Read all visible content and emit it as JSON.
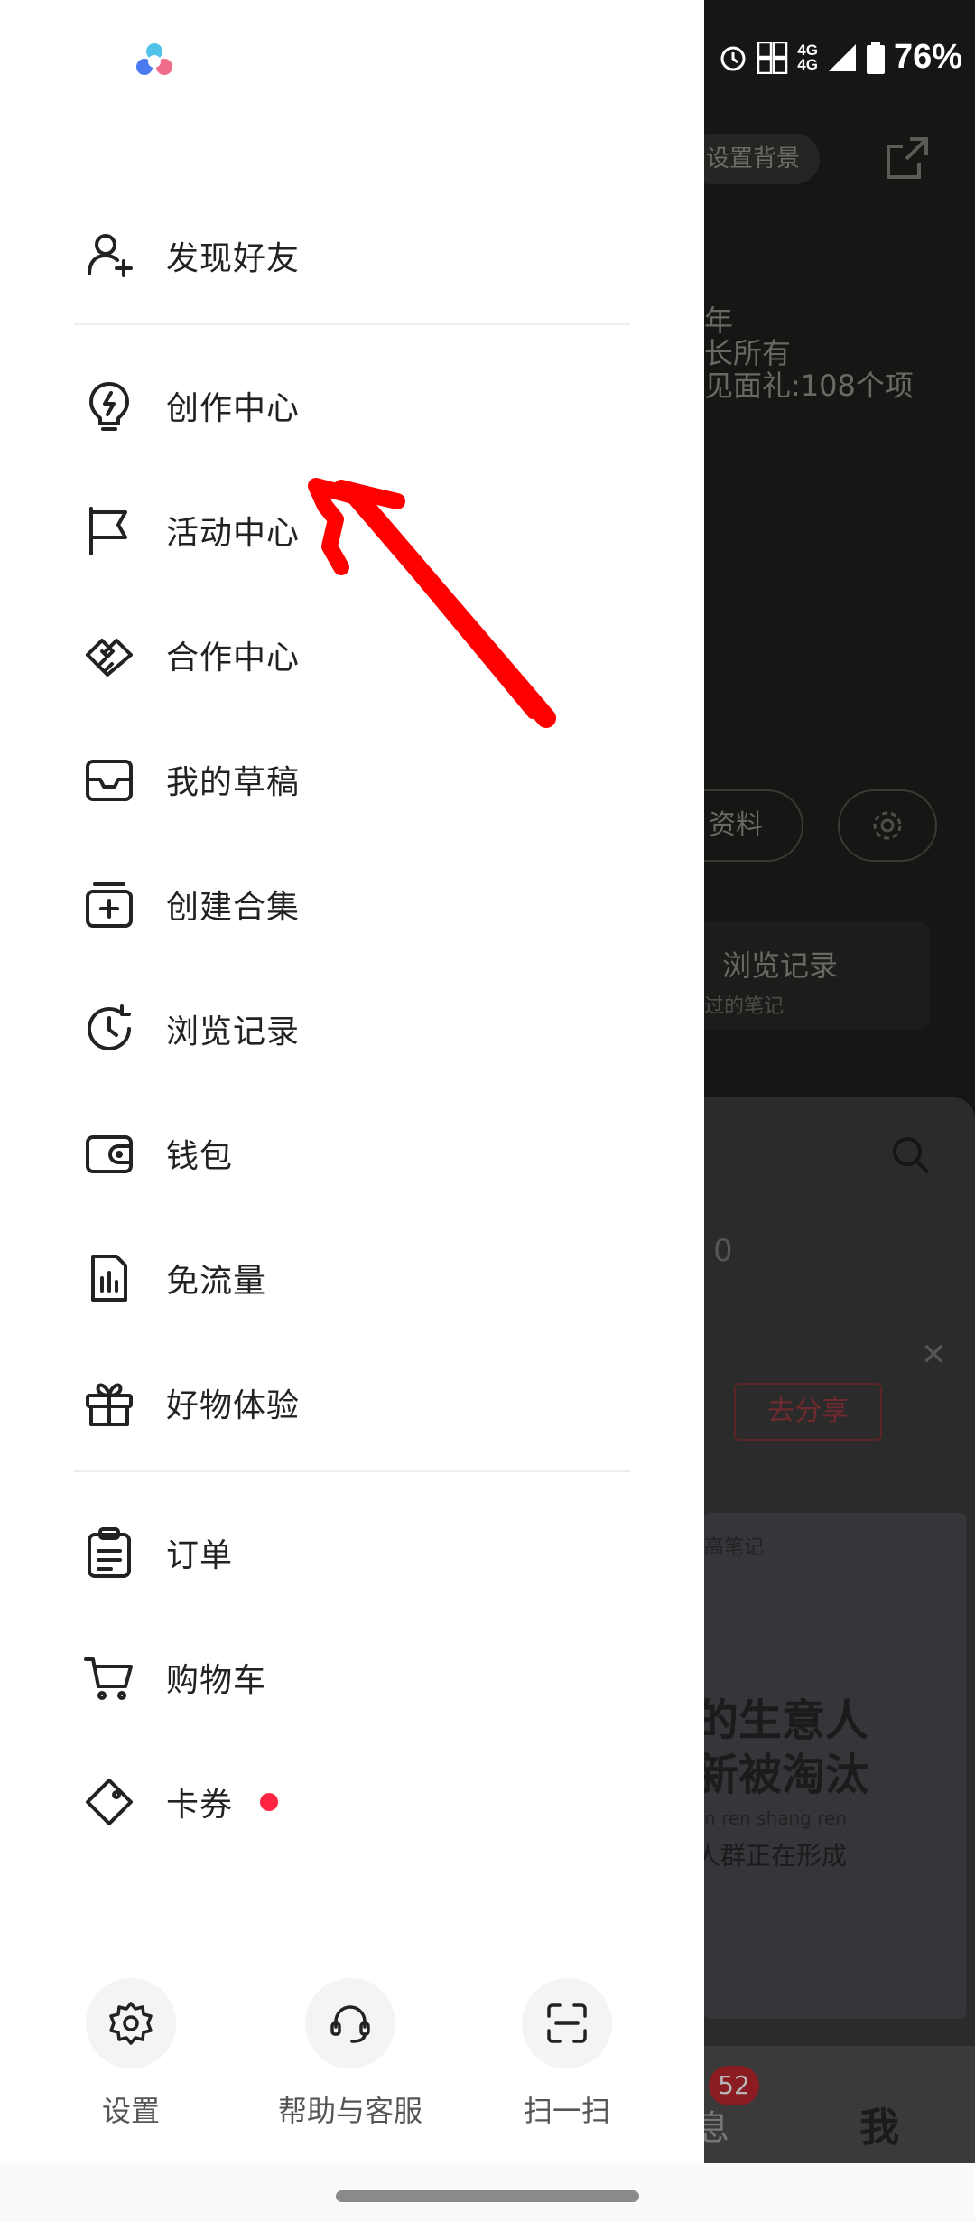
{
  "status_bar": {
    "network": "4G",
    "battery": "76%"
  },
  "background": {
    "chip_label": "设置背景",
    "profile_lines": [
      "年",
      "长所有",
      "见面礼:108个项"
    ],
    "edit_button": "资料",
    "card_title": "浏览记录",
    "card_sub": "过的笔记",
    "count": "0",
    "share_button": "去分享",
    "image_text": {
      "handwriting": "高笔记",
      "line1": "的生意人",
      "line2": "新被淘汰",
      "pinyin": "n  ren shang ren",
      "subline": "人群正在形成"
    },
    "tab_badge": "52",
    "tab_msg": "息",
    "tab_me": "我"
  },
  "drawer": {
    "groups": [
      [
        {
          "id": "find-friends",
          "label": "发现好友",
          "icon": "add-user-icon"
        }
      ],
      [
        {
          "id": "creator-center",
          "label": "创作中心",
          "icon": "lightbulb-icon"
        },
        {
          "id": "activity-center",
          "label": "活动中心",
          "icon": "flag-icon"
        },
        {
          "id": "cooperation-center",
          "label": "合作中心",
          "icon": "handshake-icon"
        },
        {
          "id": "my-drafts",
          "label": "我的草稿",
          "icon": "inbox-icon"
        },
        {
          "id": "create-collection",
          "label": "创建合集",
          "icon": "add-collection-icon"
        },
        {
          "id": "browse-history",
          "label": "浏览记录",
          "icon": "history-clock-icon"
        },
        {
          "id": "wallet",
          "label": "钱包",
          "icon": "wallet-icon"
        },
        {
          "id": "free-data",
          "label": "免流量",
          "icon": "data-chart-icon"
        },
        {
          "id": "product-trial",
          "label": "好物体验",
          "icon": "gift-icon"
        }
      ],
      [
        {
          "id": "orders",
          "label": "订单",
          "icon": "clipboard-icon"
        },
        {
          "id": "shopping-cart",
          "label": "购物车",
          "icon": "cart-icon"
        },
        {
          "id": "coupons",
          "label": "卡券",
          "icon": "ticket-icon",
          "red_dot": true
        }
      ]
    ],
    "bottom_actions": [
      {
        "id": "settings",
        "label": "设置",
        "icon": "gear-icon"
      },
      {
        "id": "help",
        "label": "帮助与客服",
        "icon": "headset-icon"
      },
      {
        "id": "scan",
        "label": "扫一扫",
        "icon": "scan-icon"
      }
    ]
  },
  "colors": {
    "accent": "#ff2442",
    "annotation": "#ff0000",
    "text": "#222222"
  }
}
